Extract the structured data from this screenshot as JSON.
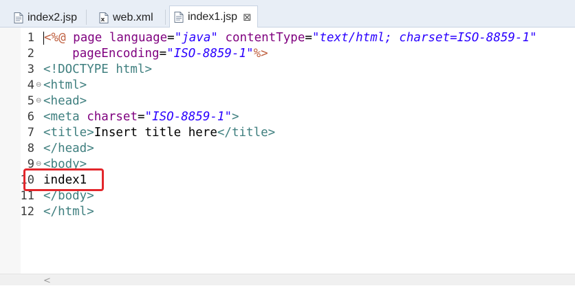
{
  "tabs": [
    {
      "label": "index2.jsp",
      "icon": "jsp-file-icon",
      "active": false
    },
    {
      "label": "web.xml",
      "icon": "xml-file-icon",
      "active": false
    },
    {
      "label": "index1.jsp",
      "icon": "jsp-file-icon",
      "active": true,
      "close_glyph": "⊠"
    }
  ],
  "editor": {
    "lines": [
      {
        "number": "1",
        "fold": ""
      },
      {
        "number": "2",
        "fold": ""
      },
      {
        "number": "3",
        "fold": ""
      },
      {
        "number": "4",
        "fold": "⊖"
      },
      {
        "number": "5",
        "fold": "⊖"
      },
      {
        "number": "6",
        "fold": ""
      },
      {
        "number": "7",
        "fold": ""
      },
      {
        "number": "8",
        "fold": ""
      },
      {
        "number": "9",
        "fold": "⊖"
      },
      {
        "number": "10",
        "fold": ""
      },
      {
        "number": "11",
        "fold": ""
      },
      {
        "number": "12",
        "fold": ""
      }
    ],
    "code": {
      "l1": {
        "open": "<%@",
        "directive": "page",
        "attr1": "language",
        "eq1": "=",
        "val1": "\"java\"",
        "attr2": "contentType",
        "eq2": "=",
        "val2": "\"text/html; charset=ISO-8859-1\""
      },
      "l2": {
        "attr": "pageEncoding",
        "eq": "=",
        "val": "\"ISO-8859-1\"",
        "close": "%>"
      },
      "l3": {
        "text": "<!DOCTYPE html>"
      },
      "l4": {
        "text": "<html>"
      },
      "l5": {
        "text": "<head>"
      },
      "l6": {
        "open": "<meta",
        "attr": "charset",
        "eq": "=",
        "val": "\"ISO-8859-1\"",
        "close": ">"
      },
      "l7": {
        "open": "<title>",
        "content": "Insert title here",
        "close": "</title>"
      },
      "l8": {
        "text": "</head>"
      },
      "l9": {
        "text": "<body>"
      },
      "l10": {
        "text": "index1"
      },
      "l11": {
        "text": "</body>"
      },
      "l12": {
        "text": "</html>"
      }
    },
    "scroll_arrow": "<"
  },
  "colors": {
    "highlight": "#e3262b",
    "tag": "#3f7f7f",
    "attribute": "#7f007f",
    "string": "#2a00ff",
    "directive_delim": "#bf5f3f"
  }
}
